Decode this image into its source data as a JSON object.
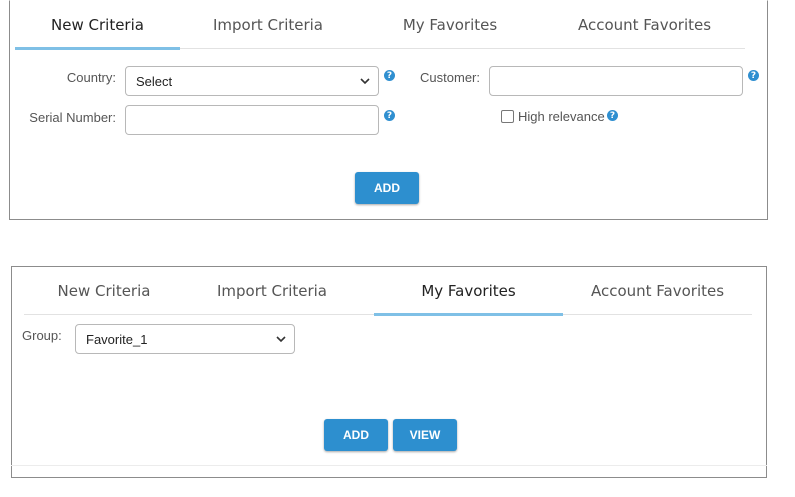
{
  "top_panel": {
    "tabs": [
      "New Criteria",
      "Import Criteria",
      "My Favorites",
      "Account Favorites"
    ],
    "active_tab": "New Criteria",
    "country_label": "Country:",
    "country_value": "Select",
    "customer_label": "Customer:",
    "customer_value": "",
    "serial_label": "Serial Number:",
    "serial_value": "",
    "high_relevance_label": "High relevance",
    "high_relevance_checked": false,
    "help_glyph": "?",
    "add_label": "ADD"
  },
  "bottom_panel": {
    "tabs": [
      "New Criteria",
      "Import Criteria",
      "My Favorites",
      "Account Favorites"
    ],
    "active_tab": "My Favorites",
    "group_label": "Group:",
    "group_value": "Favorite_1",
    "add_label": "ADD",
    "view_label": "VIEW"
  },
  "colors": {
    "accent": "#2d8fcf",
    "tab_underline": "#7fc0e6",
    "help_icon": "#2f8fd0"
  }
}
